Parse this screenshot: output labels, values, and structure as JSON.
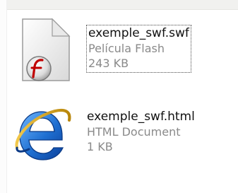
{
  "files": [
    {
      "name": "exemple_swf.swf",
      "type": "Película Flash",
      "size": "243 KB",
      "icon": "flash-movie-icon",
      "selected": true
    },
    {
      "name": "exemple_swf.html",
      "type": "HTML Document",
      "size": "1 KB",
      "icon": "internet-explorer-icon",
      "selected": false
    }
  ],
  "colors": {
    "name_text": "#111111",
    "detail_text": "#8a8a8a",
    "flash_accent": "#c00000",
    "ie_blue": "#1f6fd1"
  }
}
